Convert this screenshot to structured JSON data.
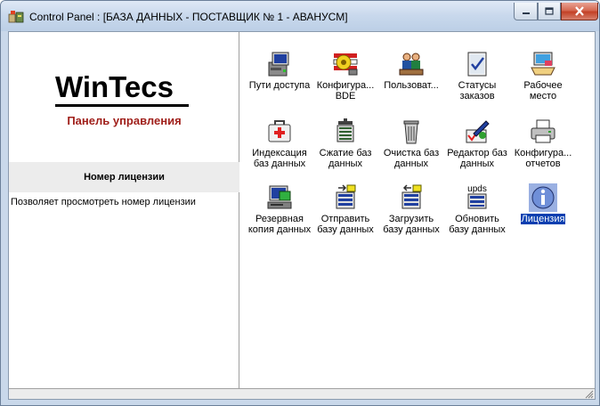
{
  "window": {
    "title": "Control Panel : [БАЗА ДАННЫХ - ПОСТАВЩИК № 1 - АВАНУСМ]",
    "icon": "control-panel-icon",
    "controls": {
      "minimize": "minimize-icon",
      "maximize": "maximize-icon",
      "close": "close-icon"
    }
  },
  "left_pane": {
    "logo_text": "WinTecs",
    "subtitle": "Панель управления",
    "selected_title": "Номер лицензии",
    "selected_description": "Позволяет просмотреть номер лицензии"
  },
  "items": [
    {
      "label1": "Пути доступа",
      "label2": "",
      "icon": "computer-icon"
    },
    {
      "label1": "Конфигура...",
      "label2": "BDE",
      "icon": "bde-config-icon"
    },
    {
      "label1": "Пользоват...",
      "label2": "",
      "icon": "users-icon"
    },
    {
      "label1": "Статусы",
      "label2": "заказов",
      "icon": "checklist-icon"
    },
    {
      "label1": "Рабочее",
      "label2": "место",
      "icon": "workplace-icon"
    },
    {
      "label1": "Индексация",
      "label2": "баз данных",
      "icon": "first-aid-icon"
    },
    {
      "label1": "Сжатие баз",
      "label2": "данных",
      "icon": "compress-icon"
    },
    {
      "label1": "Очистка баз",
      "label2": "данных",
      "icon": "trash-icon"
    },
    {
      "label1": "Редактор баз",
      "label2": "данных",
      "icon": "db-editor-icon"
    },
    {
      "label1": "Конфигура...",
      "label2": "отчетов",
      "icon": "printer-icon"
    },
    {
      "label1": "Резервная",
      "label2": "копия данных",
      "icon": "backup-icon"
    },
    {
      "label1": "Отправить",
      "label2": "базу данных",
      "icon": "send-db-icon"
    },
    {
      "label1": "Загрузить",
      "label2": "базу данных",
      "icon": "load-db-icon"
    },
    {
      "label1": "Обновить",
      "label2": "базу данных",
      "icon": "update-db-icon",
      "icon_text": "upds"
    },
    {
      "label1": "Лицензия",
      "label2": "",
      "icon": "info-icon",
      "selected": true
    }
  ],
  "colors": {
    "selection": "#0a3fb0",
    "subtitle": "#a0201b",
    "title_bar": "#c8d8ec"
  }
}
